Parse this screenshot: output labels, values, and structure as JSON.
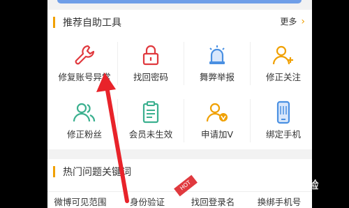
{
  "section1": {
    "title": "推荐自助工具",
    "more_label": "更多",
    "more_chevron": "›"
  },
  "tools": [
    {
      "label": "修复账号异常",
      "icon": "wrench-icon"
    },
    {
      "label": "找回密码",
      "icon": "lock-icon"
    },
    {
      "label": "舞弊举报",
      "icon": "siren-icon"
    },
    {
      "label": "修正关注",
      "icon": "user-plus-icon"
    },
    {
      "label": "修正粉丝",
      "icon": "users-icon"
    },
    {
      "label": "会员未生效",
      "icon": "clipboard-icon"
    },
    {
      "label": "申请加V",
      "icon": "user-v-icon"
    },
    {
      "label": "绑定手机",
      "icon": "phone-icon"
    }
  ],
  "section2": {
    "title": "热门问题关键词"
  },
  "keywords": [
    "微博可见范围",
    "身份验证",
    "找回登录名",
    "换绑手机号"
  ],
  "hot_badge": "HOT",
  "watermark": {
    "text": "Baid经验"
  },
  "colors": {
    "accent": "#f0a000",
    "red": "#e0393e",
    "blue": "#4a90e2",
    "green": "#3bb08f",
    "top_blue": "#6f9ee8"
  }
}
